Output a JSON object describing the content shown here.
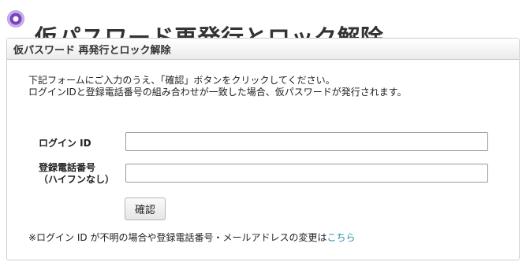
{
  "page": {
    "title": "仮パスワード再発行とロック解除"
  },
  "panel": {
    "header": "仮パスワード 再発行とロック解除",
    "description": {
      "line1": "下記フォームにご入力のうえ、「確認」ボタンをクリックしてください。",
      "line2": "ログインIDと登録電話番号の組み合わせが一致した場合、仮パスワードが発行されます。"
    },
    "form": {
      "login_label": "ログイン ID",
      "login_value": "",
      "phone_label_line1": "登録電話番号",
      "phone_label_line2": "（ハイフンなし）",
      "phone_value": "",
      "confirm_label": "確認"
    },
    "note": {
      "text": "※ログイン ID が不明の場合や登録電話番号・メールアドレスの変更は",
      "link": "こちら"
    }
  },
  "colors": {
    "link": "#2c8fa8",
    "title_bullet": "#7a3fc4"
  },
  "icons": {
    "title_bullet": "purple-circle-icon"
  }
}
